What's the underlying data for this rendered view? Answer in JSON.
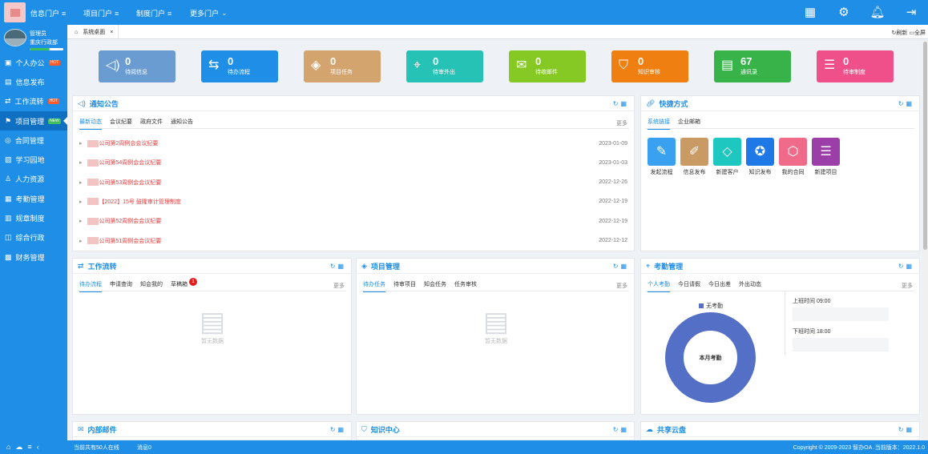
{
  "topnav": [
    {
      "label": "信息门户",
      "icon": "≡"
    },
    {
      "label": "项目门户",
      "icon": "≡"
    },
    {
      "label": "制度门户",
      "icon": "≡"
    },
    {
      "label": "更多门户",
      "icon": "⌄"
    }
  ],
  "topicons": [
    "apps-icon",
    "settings-icon",
    "bell-icon",
    "logout-icon"
  ],
  "user": {
    "name": "管理员",
    "dept": "重庆行政部"
  },
  "sidebar": [
    {
      "label": "个人办公",
      "icon": "▣",
      "badge": "HOT"
    },
    {
      "label": "信息发布",
      "icon": "▤",
      "badge": ""
    },
    {
      "label": "工作流转",
      "icon": "⇄",
      "badge": "HOT"
    },
    {
      "label": "项目管理",
      "icon": "⚑",
      "badge": "NEW"
    },
    {
      "label": "合同管理",
      "icon": "◎",
      "badge": ""
    },
    {
      "label": "学习园地",
      "icon": "▧",
      "badge": ""
    },
    {
      "label": "人力资源",
      "icon": "♙",
      "badge": ""
    },
    {
      "label": "考勤管理",
      "icon": "▦",
      "badge": ""
    },
    {
      "label": "规章制度",
      "icon": "▥",
      "badge": ""
    },
    {
      "label": "综合行政",
      "icon": "◫",
      "badge": ""
    },
    {
      "label": "财务管理",
      "icon": "▩",
      "badge": ""
    }
  ],
  "tab": {
    "label": "系统桌面",
    "close": "×"
  },
  "tabtools": {
    "refresh": "刷新",
    "full": "全屏"
  },
  "tiles": [
    {
      "num": "0",
      "label": "待阅信息",
      "color": "#6a9cd2",
      "icon": "◁)"
    },
    {
      "num": "0",
      "label": "待办流程",
      "color": "#1e8ee6",
      "icon": "⇆"
    },
    {
      "num": "0",
      "label": "项目任务",
      "color": "#d4a46f",
      "icon": "◈"
    },
    {
      "num": "0",
      "label": "待审外出",
      "color": "#26c2b6",
      "icon": "⌖"
    },
    {
      "num": "0",
      "label": "待收邮件",
      "color": "#86c824",
      "icon": "✉"
    },
    {
      "num": "0",
      "label": "知识审核",
      "color": "#f07f11",
      "icon": "⛉"
    },
    {
      "num": "67",
      "label": "通讯录",
      "color": "#37b34a",
      "icon": "▤"
    },
    {
      "num": "0",
      "label": "待审制度",
      "color": "#f0508a",
      "icon": "☰"
    }
  ],
  "notice": {
    "title": "通知公告",
    "tabs": [
      "最新动态",
      "会议纪要",
      "政府文件",
      "通知公告"
    ],
    "more": "更多",
    "rows": [
      {
        "title": "公司第2周例会会议纪要",
        "date": "2023-01-09"
      },
      {
        "title": "公司第54周例会会议纪要",
        "date": "2023-01-03"
      },
      {
        "title": "公司第53周例会会议纪要",
        "date": "2022-12-26"
      },
      {
        "title": "【2022】15号 鼓隆审计管理制度",
        "date": "2022-12-19"
      },
      {
        "title": "公司第52周例会会议纪要",
        "date": "2022-12-19"
      },
      {
        "title": "公司第51周例会会议纪要",
        "date": "2022-12-12"
      }
    ]
  },
  "shortcuts": {
    "title": "快捷方式",
    "tabs": [
      "系统链接",
      "企业邮箱"
    ],
    "items": [
      {
        "label": "发起流程",
        "color": "#3aa0f0",
        "icon": "✎"
      },
      {
        "label": "信息发布",
        "color": "#c99a64",
        "icon": "✐"
      },
      {
        "label": "新建客户",
        "color": "#1ec7c0",
        "icon": "◇"
      },
      {
        "label": "知识发布",
        "color": "#1e78e6",
        "icon": "✪"
      },
      {
        "label": "我的合同",
        "color": "#f06a8a",
        "icon": "⬡"
      },
      {
        "label": "新建项目",
        "color": "#9b3ea8",
        "icon": "☰"
      }
    ]
  },
  "workflow": {
    "title": "工作流转",
    "tabs": [
      "待办流程",
      "申请查询",
      "知会我的",
      "草稿箱"
    ],
    "badge": "1",
    "more": "更多",
    "empty": "暂无数据"
  },
  "project": {
    "title": "项目管理",
    "tabs": [
      "待办任务",
      "待审项目",
      "知会任务",
      "任务审核"
    ],
    "more": "更多",
    "empty": "暂无数据"
  },
  "attendance": {
    "title": "考勤管理",
    "tabs": [
      "个人考勤",
      "今日请假",
      "今日出差",
      "外出动态"
    ],
    "more": "更多",
    "legend": "无考勤",
    "center": "本月考勤",
    "on_time": "上班时间 09:00",
    "off_time": "下班时间 18:00",
    "ring_color": "#5470c6"
  },
  "bottom_panels": [
    "内部邮件",
    "知识中心",
    "共享云盘"
  ],
  "status": {
    "online": "当前共有50人在线",
    "msg": "消息0",
    "copyright": "Copyright © 2009-2023 智办OA .当前版本：2022.1.0"
  }
}
